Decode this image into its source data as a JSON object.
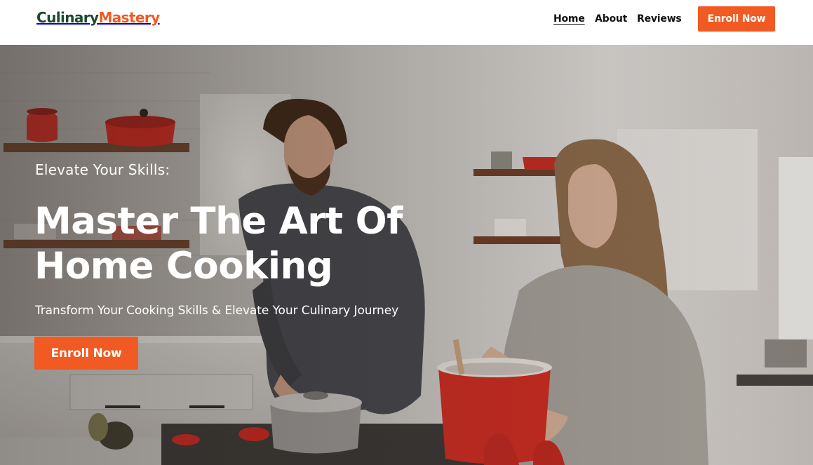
{
  "header": {
    "logo_part_a": "Culinary",
    "logo_part_b": "Mastery",
    "nav": [
      {
        "label": "Home",
        "active": true
      },
      {
        "label": "About",
        "active": false
      },
      {
        "label": "Reviews",
        "active": false
      }
    ],
    "cta_label": "Enroll Now"
  },
  "hero": {
    "eyebrow": "Elevate Your Skills:",
    "title": "Master The Art Of Home Cooking",
    "subtitle": "Transform Your Cooking Skills & Elevate Your Culinary Journey",
    "cta_label": "Enroll Now",
    "image_alt": "couple-cooking-in-kitchen-photo"
  },
  "colors": {
    "brand_dark_green": "#1d4a2e",
    "brand_orange": "#f15a22",
    "nav_text": "#111111",
    "hero_text": "#ffffff"
  }
}
